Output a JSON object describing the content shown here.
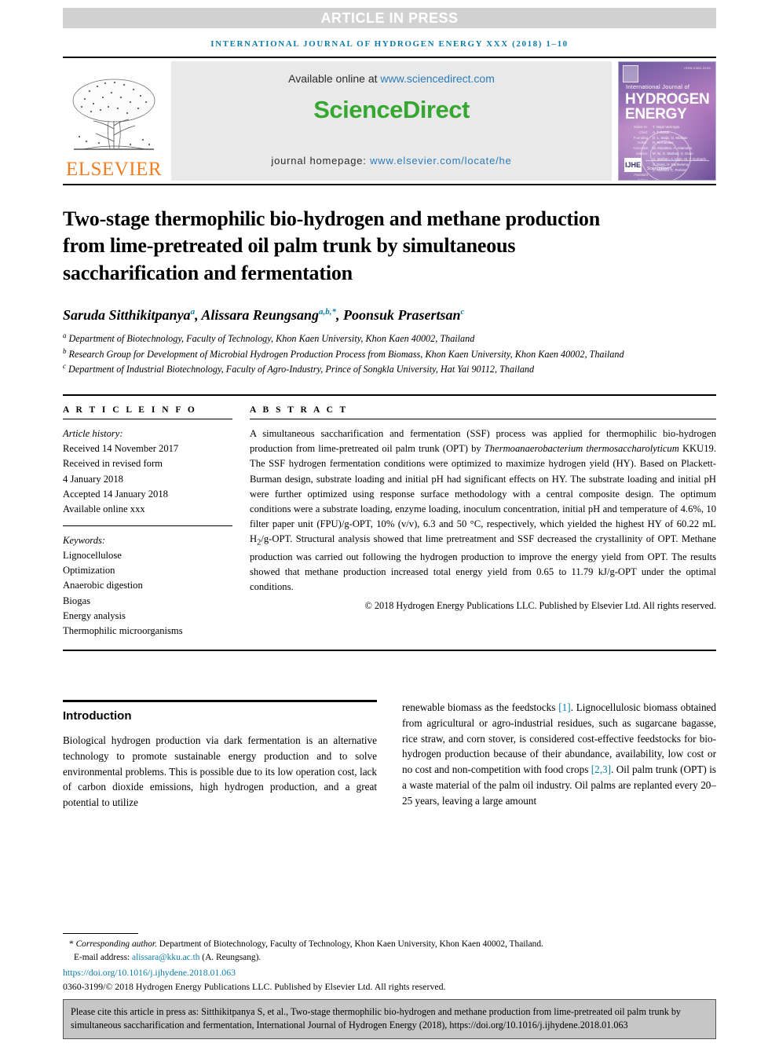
{
  "banner": {
    "press_label": "ARTICLE IN PRESS",
    "running_head": "International Journal of Hydrogen Energy xxx (2018) 1–10"
  },
  "masthead": {
    "publisher_name": "ELSEVIER",
    "available_prefix": "Available online at ",
    "sciencedirect_url": "www.sciencedirect.com",
    "sciencedirect_logo": "ScienceDirect",
    "homepage_prefix": "journal homepage: ",
    "homepage_url": "www.elsevier.com/locate/he",
    "cover": {
      "isbn_text": "ISSN 0360-3199",
      "line_small": "International Journal of",
      "line1": "HYDROGEN",
      "line2": "ENERGY",
      "labels": [
        "Editor-in-Chief:",
        "Founding Editor:",
        "Associate Editors:",
        "Assistant Editor:"
      ],
      "names": "T. Nejat Veziroglu\nA. T-Raissi\nD. L. Stojic, G. Marban\nR. Fernandes\nM. Momirlan, A. Adamson\nM. Ni, G. Marban, S. Dunn\nG. Marban, A. Ingle, M. T. Gorbach\nS. Dunn, H. Barthelemy\nS. Mahishi, C. Perkins",
      "badge": "IJHE",
      "foot": "ScienceDirect"
    }
  },
  "article": {
    "title": "Two-stage thermophilic bio-hydrogen and methane production from lime-pretreated oil palm trunk by simultaneous saccharification and fermentation",
    "authors": [
      {
        "name": "Saruda Sitthikitpanya",
        "marks": "a"
      },
      {
        "name": "Alissara Reungsang",
        "marks": "a,b,*"
      },
      {
        "name": "Poonsuk Prasertsan",
        "marks": "c"
      }
    ],
    "affiliations": [
      {
        "mark": "a",
        "text": "Department of Biotechnology, Faculty of Technology, Khon Kaen University, Khon Kaen 40002, Thailand"
      },
      {
        "mark": "b",
        "text": "Research Group for Development of Microbial Hydrogen Production Process from Biomass, Khon Kaen University, Khon Kaen 40002, Thailand"
      },
      {
        "mark": "c",
        "text": "Department of Industrial Biotechnology, Faculty of Agro-Industry, Prince of Songkla University, Hat Yai 90112, Thailand"
      }
    ]
  },
  "info": {
    "section_label": "A R T I C L E  I N F O",
    "history_label": "Article history:",
    "history": [
      "Received 14 November 2017",
      "Received in revised form",
      "4 January 2018",
      "Accepted 14 January 2018",
      "Available online xxx"
    ],
    "keywords_label": "Keywords:",
    "keywords": [
      "Lignocellulose",
      "Optimization",
      "Anaerobic digestion",
      "Biogas",
      "Energy analysis",
      "Thermophilic microorganisms"
    ]
  },
  "abstract": {
    "section_label": "A B S T R A C T",
    "part1": "A simultaneous saccharification and fermentation (SSF) process was applied for thermophilic bio-hydrogen production from lime-pretreated oil palm trunk (OPT) by ",
    "italic1": "Thermoanaerobacterium thermosaccharolyticum",
    "part2": " KKU19. The SSF hydrogen fermentation conditions were optimized to maximize hydrogen yield (HY). Based on Plackett-Burman design, substrate loading and initial pH had significant effects on HY. The substrate loading and initial pH were further optimized using response surface methodology with a central composite design. The optimum conditions were a substrate loading, enzyme loading, inoculum concentration, initial pH and temperature of 4.6%, 10 filter paper unit (FPU)/g-OPT, 10% (v/v), 6.3 and 50 °C, respectively, which yielded the highest HY of 60.22 mL H",
    "sub1": "2",
    "part3": "/g-OPT. Structural analysis showed that lime pretreatment and SSF decreased the crystallinity of OPT. Methane production was carried out following the hydrogen production to improve the energy yield from OPT. The results showed that methane production increased total energy yield from 0.65 to 11.79 kJ/g-OPT under the optimal conditions.",
    "copyright": "© 2018 Hydrogen Energy Publications LLC. Published by Elsevier Ltd. All rights reserved."
  },
  "intro": {
    "heading": "Introduction",
    "left_text": "Biological hydrogen production via dark fermentation is an alternative technology to promote sustainable energy production and to solve environmental problems. This is possible due to its low operation cost, lack of carbon dioxide emissions, high hydrogen production, and a great potential to utilize",
    "right": {
      "t1": "renewable biomass as the feedstocks ",
      "cite1": "[1]",
      "t2": ". Lignocellulosic biomass obtained from agricultural or agro-industrial residues, such as sugarcane bagasse, rice straw, and corn stover, is considered cost-effective feedstocks for bio-hydrogen production because of their abundance, availability, low cost or no cost and non-competition with food crops ",
      "cite2": "[2,3]",
      "t3": ". Oil palm trunk (OPT) is a waste material of the palm oil industry. Oil palms are replanted every 20–25 years, leaving a large amount"
    }
  },
  "footnotes": {
    "corresponding_label": "Corresponding author.",
    "corresponding_text": " Department of Biotechnology, Faculty of Technology, Khon Kaen University, Khon Kaen 40002, Thailand.",
    "email_label": "E-mail address: ",
    "email": "alissara@kku.ac.th",
    "email_suffix": " (A. Reungsang).",
    "doi": "https://doi.org/10.1016/j.ijhydene.2018.01.063",
    "issn": "0360-3199/© 2018 Hydrogen Energy Publications LLC. Published by Elsevier Ltd. All rights reserved."
  },
  "cite_box": {
    "text": "Please cite this article in press as: Sitthikitpanya S, et al., Two-stage thermophilic bio-hydrogen and methane production from lime-pretreated oil palm trunk by simultaneous saccharification and fermentation, International Journal of Hydrogen Energy (2018), https://doi.org/10.1016/j.ijhydene.2018.01.063"
  },
  "colors": {
    "link_blue": "#2b7bba",
    "teal": "#0b7ca8",
    "elsevier_orange": "#f47d20",
    "sciencedirect_green": "#36a832",
    "press_band": "#d2d2d2",
    "cite_box_bg": "#c6c6c6"
  }
}
